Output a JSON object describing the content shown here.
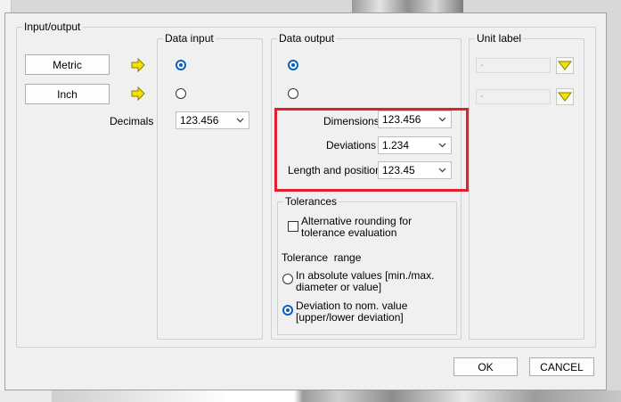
{
  "input_output": {
    "title": "Input/output",
    "metric_button": "Metric",
    "inch_button": "Inch",
    "decimals_label": "Decimals"
  },
  "data_input": {
    "title": "Data input",
    "metric_selected": true,
    "inch_selected": false,
    "decimals_value": "123.456"
  },
  "data_output": {
    "title": "Data output",
    "metric_selected": true,
    "inch_selected": false,
    "dimensions_label": "Dimensions",
    "dimensions_value": "123.456",
    "deviations_label": "Deviations",
    "deviations_value": "1.234",
    "length_label": "Length and position",
    "length_value": "123.45"
  },
  "tolerances": {
    "title": "Tolerances",
    "alt_rounding_label": "Alternative rounding for tolerance evaluation",
    "alt_rounding_checked": false,
    "range_label": "Tolerance  range",
    "absolute_label_1": "In absolute values [min./max.",
    "absolute_label_2": "diameter or value]",
    "deviation_label_1": "Deviation to nom. value",
    "deviation_label_2": "[upper/lower deviation]",
    "selected_option": "deviation"
  },
  "unit_label": {
    "title": "Unit label",
    "metric_value": "-",
    "inch_value": "-"
  },
  "footer": {
    "ok_label": "OK",
    "cancel_label": "CANCEL"
  },
  "colors": {
    "highlight": "#e0202a",
    "radio_accent": "#0a5fc1",
    "arrow_yellow": "#f2e400"
  }
}
